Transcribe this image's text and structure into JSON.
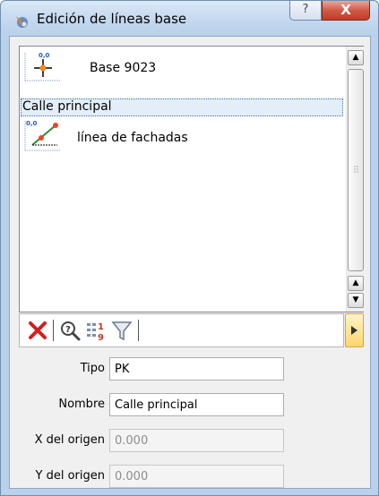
{
  "window": {
    "title": "Edición de líneas base",
    "help_label": "?",
    "close_label": "X"
  },
  "list": {
    "items": [
      {
        "label": "Base 9023",
        "icon": "base-point-icon",
        "selected": false
      },
      {
        "label": "Calle principal",
        "icon": "",
        "selected": true
      },
      {
        "label": "línea de fachadas",
        "icon": "baseline-line-icon",
        "selected": false
      }
    ],
    "icon_value": "0,0"
  },
  "toolbar": {
    "buttons": [
      "delete-icon",
      "query-icon",
      "numbering-icon",
      "filter-icon"
    ]
  },
  "form": {
    "tipo_label": "Tipo",
    "tipo_value": "PK",
    "nombre_label": "Nombre",
    "nombre_value": "Calle principal",
    "x_label": "X del origen",
    "x_value": "0.000",
    "y_label": "Y del origen",
    "y_value": "0.000"
  },
  "colors": {
    "accent_delete": "#d21f1f",
    "selection": "#e4eef9",
    "close": "#c23b22"
  }
}
